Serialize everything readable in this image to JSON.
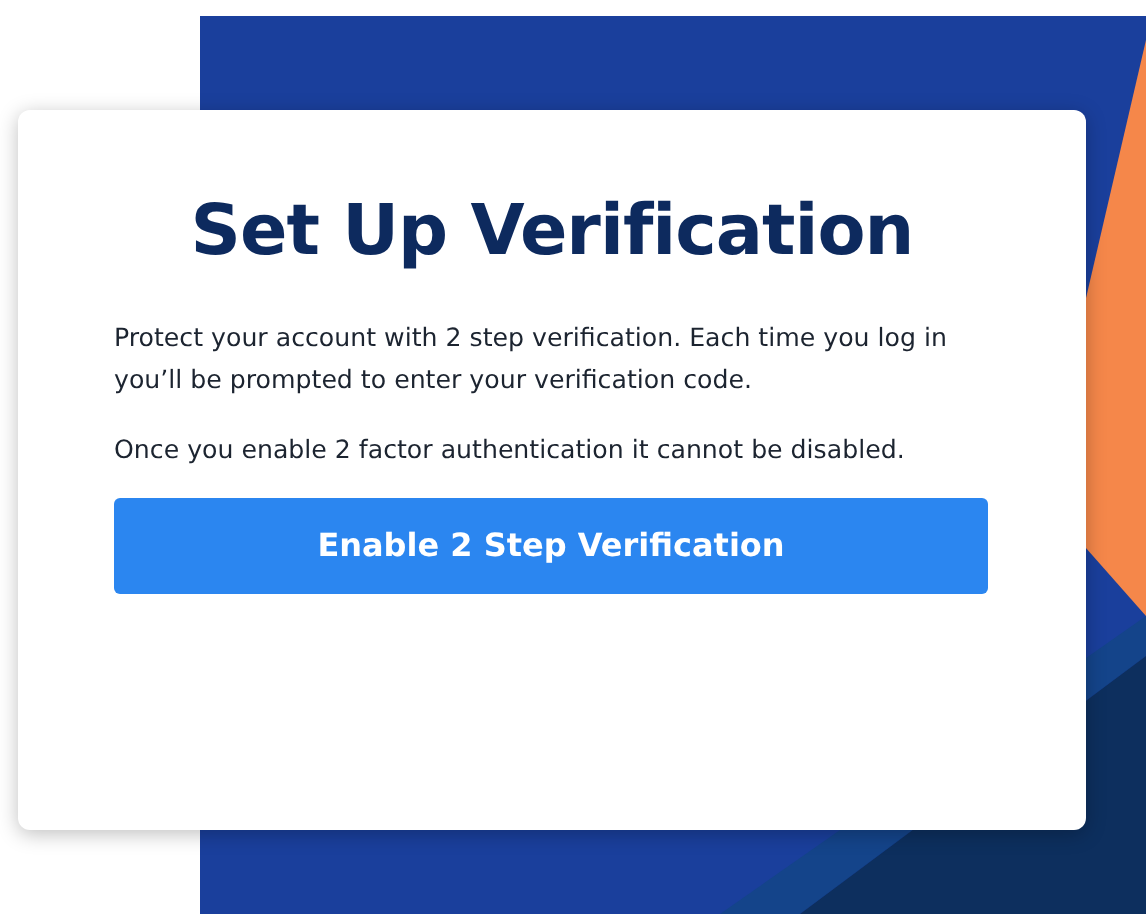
{
  "card": {
    "title": "Set Up Verification",
    "paragraphs": [
      "Protect your account with 2 step verification. Each time you log in you’ll be prompted to enter your verification code.",
      "Once you enable 2 factor authentication it cannot be disabled."
    ],
    "button": {
      "label": "Enable 2 Step Verification"
    }
  }
}
